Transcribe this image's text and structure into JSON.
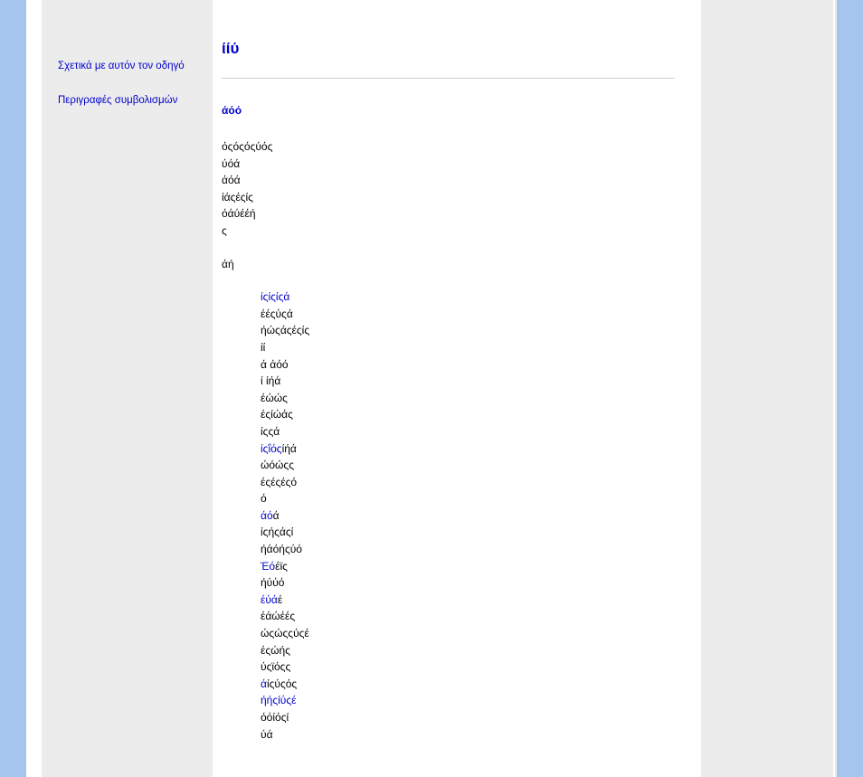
{
  "sidebar": {
    "items": [
      {
        "label": "Σχετικά με αυτόν τον οδηγό"
      },
      {
        "label": "Περιγραφές συμβολισμών"
      }
    ]
  },
  "main": {
    "title": "ίίύ",
    "subheading": "άόό",
    "block1": [
      "όςόςόςύός",
      "ύόά",
      "άόά",
      "ίάςέςίς",
      "όάύέέή",
      "ς"
    ],
    "block2": [
      "άή"
    ],
    "block3": [
      {
        "text": "ίςίςίςά",
        "link": true
      },
      {
        "text": "έέςύςά"
      },
      {
        "text": "ήώςάςέςίς"
      },
      {
        "text": "ίί"
      },
      {
        "text": "ά  άόό"
      },
      {
        "text": "ί  ίήά"
      },
      {
        "text": "έώώς"
      },
      {
        "text": "έςίώάς"
      },
      {
        "text": "ίςςά"
      },
      {
        "text": "ίςΐόςίήά",
        "partial_link": "ίςΐός"
      },
      {
        "text": "ώόώςς"
      },
      {
        "text": "έςέςέςό"
      },
      {
        "text": "ό"
      },
      {
        "text": "άόά",
        "partial_link": "άό"
      },
      {
        "text": "ίςήςάςί"
      },
      {
        "text": "ήάόήςύό"
      },
      {
        "text": "Έόέϊς",
        "partial_link": "Έό"
      },
      {
        "text": "ήύύό"
      },
      {
        "text": "έύάέ",
        "partial_link": "έύά"
      },
      {
        "text": "έάώέές"
      },
      {
        "text": "ώςώςςύςέ"
      },
      {
        "text": "έςώής"
      },
      {
        "text": "ύςϊόςς"
      },
      {
        "text": "άίςύςός",
        "partial_link": "ά"
      },
      {
        "text": "ήήςίύςέ",
        "link": true
      },
      {
        "text": "όόίόςί"
      },
      {
        "text": "ύά"
      }
    ]
  }
}
